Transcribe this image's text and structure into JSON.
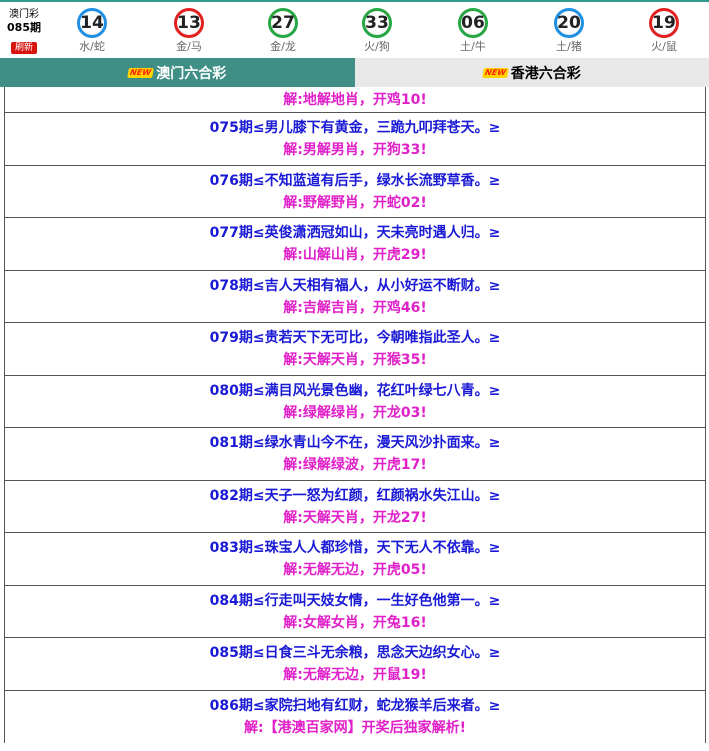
{
  "draw": {
    "lottery_name": "澳门彩",
    "period": "085期",
    "refresh_label": "刷新",
    "balls": [
      {
        "number": "14",
        "label": "水/蛇",
        "color": "blue"
      },
      {
        "number": "13",
        "label": "金/马",
        "color": "red"
      },
      {
        "number": "27",
        "label": "金/龙",
        "color": "green"
      },
      {
        "number": "33",
        "label": "火/狗",
        "color": "green"
      },
      {
        "number": "06",
        "label": "土/牛",
        "color": "green"
      },
      {
        "number": "20",
        "label": "土/猪",
        "color": "blue"
      },
      {
        "number": "19",
        "label": "火/鼠",
        "color": "red"
      }
    ]
  },
  "tabs": [
    {
      "label": "澳门六合彩",
      "badge": "NEW",
      "active": true
    },
    {
      "label": "香港六合彩",
      "badge": "NEW",
      "active": false
    }
  ],
  "predictions": {
    "first_answer": "解:地解地肖，开鸡10!",
    "rows": [
      {
        "question": "075期≤男儿膝下有黄金，三跪九叩拜苍天。≥",
        "answer": "解:男解男肖，开狗33!"
      },
      {
        "question": "076期≤不知蓝道有后手，绿水长流野草香。≥",
        "answer": "解:野解野肖，开蛇02!"
      },
      {
        "question": "077期≤英俊潇洒冠如山，天未亮时遇人归。≥",
        "answer": "解:山解山肖，开虎29!"
      },
      {
        "question": "078期≤吉人天相有福人，从小好运不断财。≥",
        "answer": "解:吉解吉肖，开鸡46!"
      },
      {
        "question": "079期≤贵若天下无可比，今朝唯指此圣人。≥",
        "answer": "解:天解天肖，开猴35!"
      },
      {
        "question": "080期≤满目风光景色幽，花红叶绿七八青。≥",
        "answer": "解:绿解绿肖，开龙03!"
      },
      {
        "question": "081期≤绿水青山今不在，漫天风沙扑面来。≥",
        "answer": "解:绿解绿波，开虎17!"
      },
      {
        "question": "082期≤天子一怒为红颜，红颜祸水失江山。≥",
        "answer": "解:天解天肖，开龙27!"
      },
      {
        "question": "083期≤珠宝人人都珍惜，天下无人不依靠。≥",
        "answer": "解:无解无边，开虎05!"
      },
      {
        "question": "084期≤行走叫天妓女情，一生好色他第一。≥",
        "answer": "解:女解女肖，开兔16!"
      },
      {
        "question": "085期≤日食三斗无余粮，思念天边织女心。≥",
        "answer": "解:无解无边，开鼠19!"
      },
      {
        "question": "086期≤家院扫地有红财，蛇龙猴羊后来者。≥",
        "answer": "解:【港澳百家网】开奖后独家解析!"
      }
    ]
  },
  "colors": {
    "question_text": "#1a1ad6",
    "answer_text": "#e020c8",
    "active_tab": "#3f8f86",
    "inactive_tab": "#e8e8e8",
    "refresh_button": "#d9140f"
  }
}
